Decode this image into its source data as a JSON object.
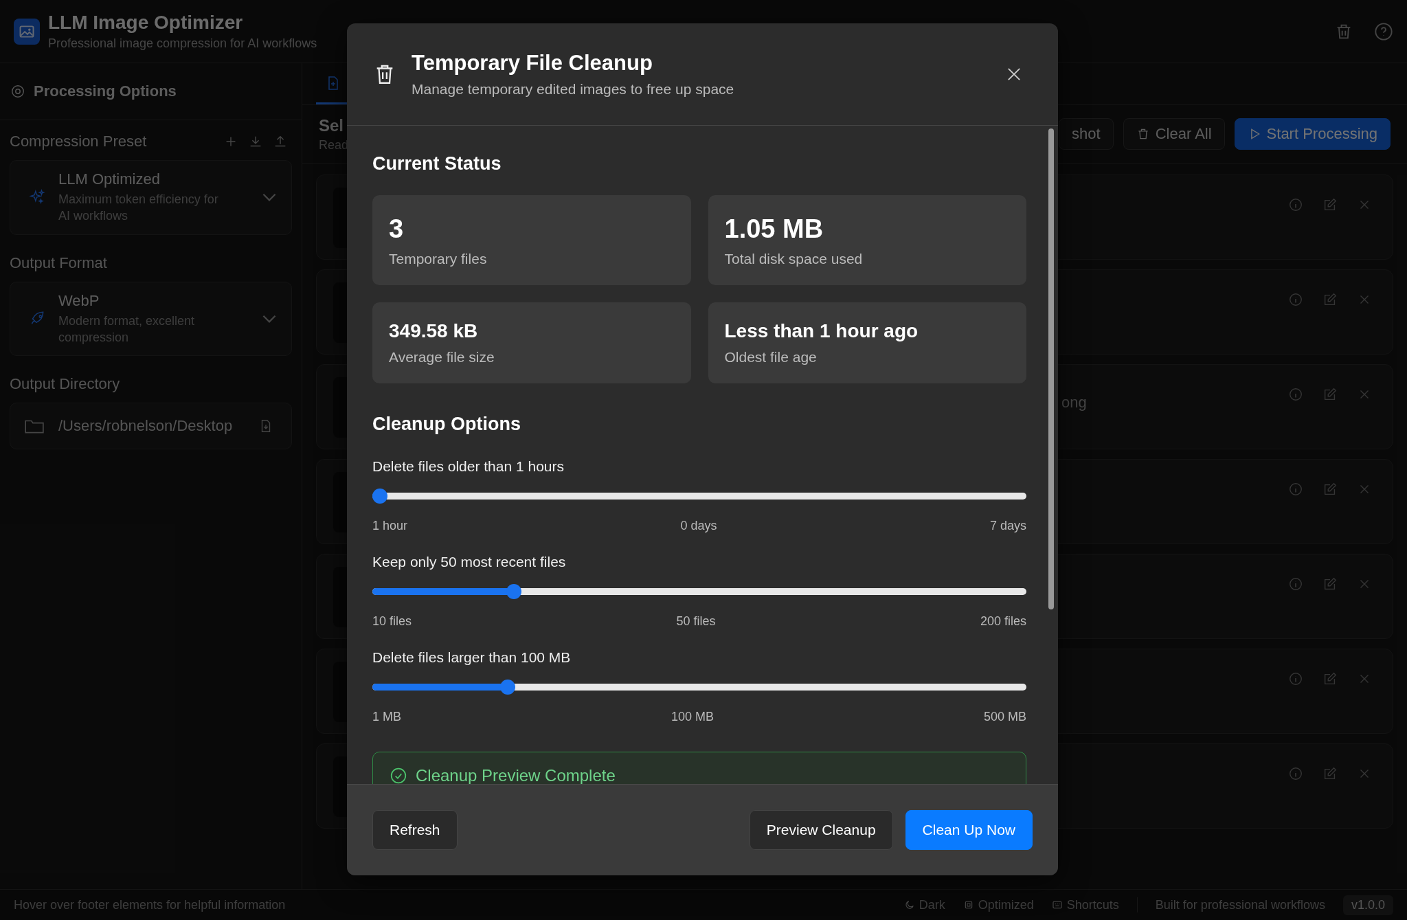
{
  "app": {
    "title": "LLM Image Optimizer",
    "subtitle": "Professional image compression for AI workflows"
  },
  "sidebar": {
    "title": "Processing Options",
    "sections": [
      {
        "kind": "select",
        "label": "Compression Preset",
        "name": "LLM Optimized",
        "description": "Maximum token efficiency for AI workflows"
      },
      {
        "kind": "select",
        "label": "Output Format",
        "name": "WebP",
        "description": "Modern format, excellent compression"
      },
      {
        "kind": "path",
        "label": "Output Directory",
        "name": "/Users/robnelson/Desktop"
      }
    ]
  },
  "main": {
    "tabs": [
      {
        "selected": true
      }
    ],
    "heading": "Sel",
    "subheading": "Read",
    "buttons": [
      {
        "label": "shot",
        "kind": "outline"
      },
      {
        "label": "Clear All",
        "kind": "trash"
      },
      {
        "label": "Start Processing",
        "kind": "primary"
      }
    ],
    "rows": [
      {
        "kind": "file"
      },
      {
        "kind": "file"
      },
      {
        "kind": "file",
        "name": "ong"
      },
      {
        "kind": "file"
      },
      {
        "kind": "file"
      },
      {
        "kind": "file"
      },
      {
        "kind": "file"
      }
    ]
  },
  "modal": {
    "title": "Temporary File Cleanup",
    "subtitle": "Manage temporary edited images to free up space",
    "status_title": "Current Status",
    "stats": [
      {
        "value": "3",
        "label": "Temporary files"
      },
      {
        "value": "1.05 MB",
        "label": "Total disk space used"
      },
      {
        "value": "349.58 kB",
        "label": "Average file size"
      },
      {
        "value": "Less than 1 hour ago",
        "label": "Oldest file age"
      }
    ],
    "options_title": "Cleanup Options",
    "sliders": [
      {
        "label": "Delete files older than 1 hours",
        "level": 0,
        "ticks": [
          "1 hour",
          "0 days",
          "7 days"
        ]
      },
      {
        "label": "Keep only 50 most recent files",
        "level": 0.21,
        "ticks": [
          "10 files",
          "50 files",
          "200 files"
        ]
      },
      {
        "label": "Delete files larger than 100 MB",
        "level": 0.2,
        "ticks": [
          "1 MB",
          "100 MB",
          "500 MB"
        ]
      }
    ],
    "notice": {
      "title": "Cleanup Preview Complete"
    },
    "buttons": [
      {
        "label": "Refresh",
        "kind": "secondary"
      },
      {
        "label": "Preview Cleanup",
        "kind": "secondary"
      },
      {
        "label": "Clean Up Now",
        "kind": "primary"
      }
    ]
  },
  "footer": {
    "hint": "Hover over footer elements for helpful information",
    "items": [
      {
        "label": "Dark"
      },
      {
        "label": "Optimized"
      },
      {
        "label": "Shortcuts"
      }
    ],
    "credit": "Built for professional workflows",
    "version": "v1.0.0"
  }
}
